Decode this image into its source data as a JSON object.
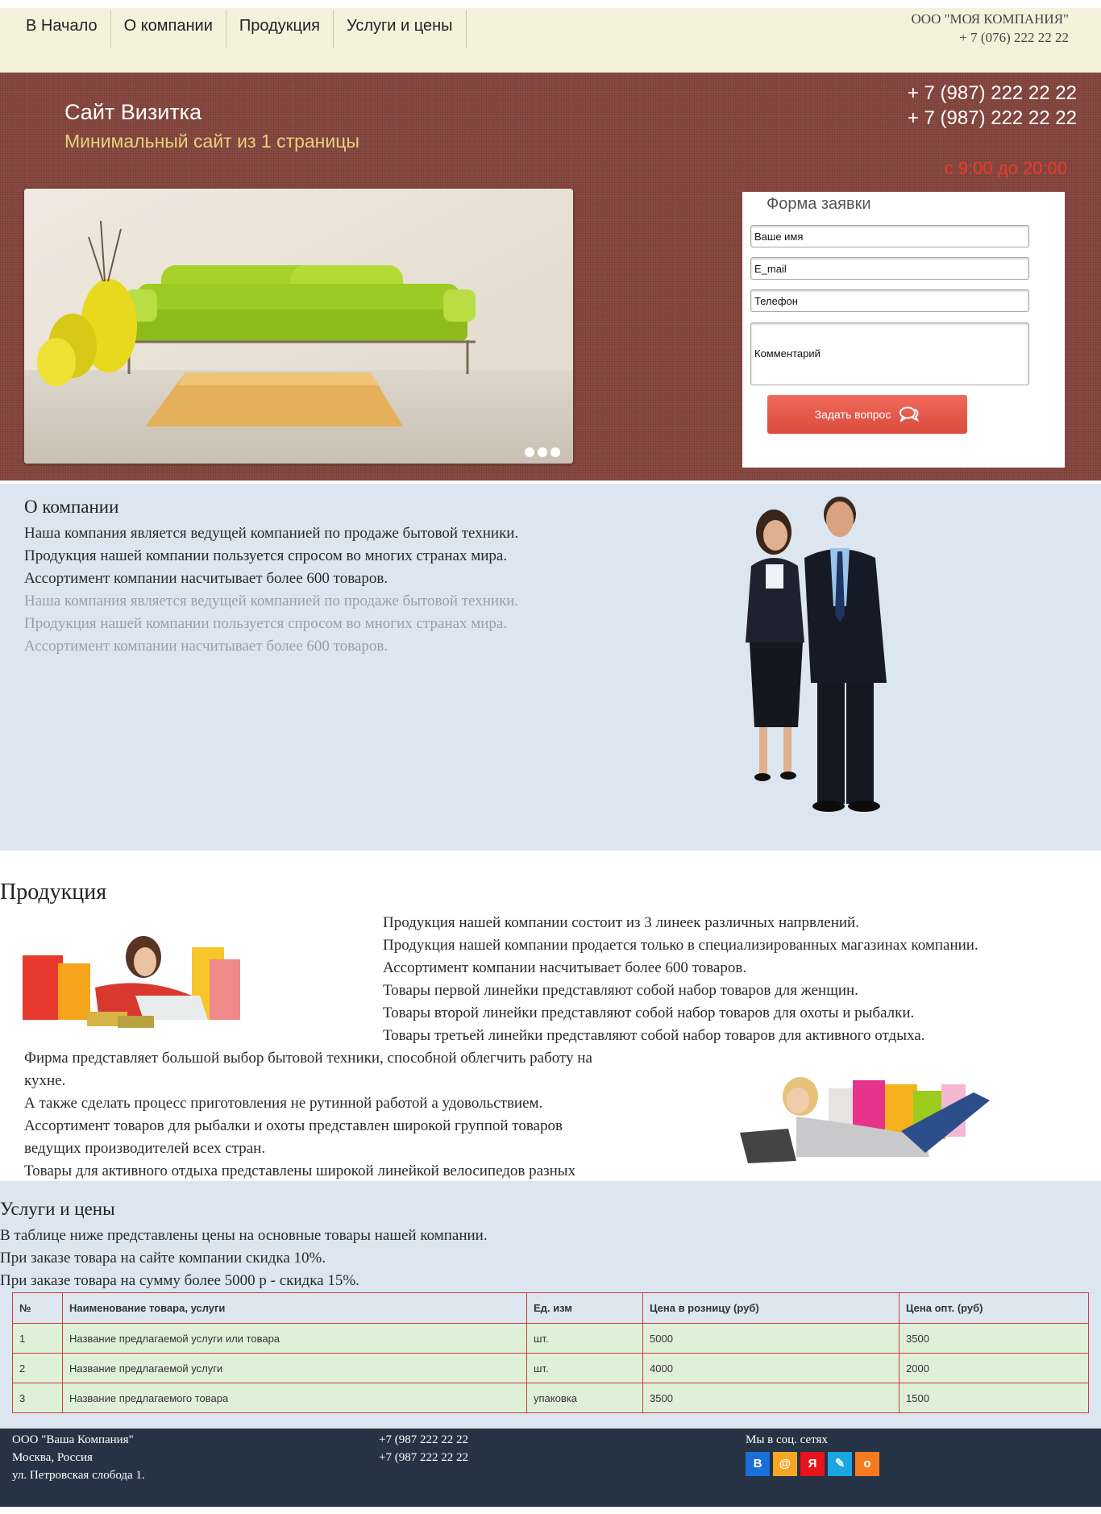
{
  "nav": {
    "items": [
      "В Начало",
      "О компании",
      "Продукция",
      "Услуги и цены"
    ]
  },
  "company_box": {
    "name": "ООО \"МОЯ КОМПАНИЯ\"",
    "phone": "+ 7 (076) 222 22 22"
  },
  "hero": {
    "title": "Сайт Визитка",
    "subtitle": "Минимальный сайт из 1 страницы",
    "phone1": "+ 7 (987) 222 22 22",
    "phone2": "+ 7 (987) 222 22 22",
    "hours": "с 9:00 до 20:00",
    "hours_color": "#ec3a2a",
    "background_color": "#8a4a43"
  },
  "form": {
    "title": "Форма заявки",
    "name_placeholder": "Ваше имя",
    "email_placeholder": "E_mail",
    "phone_placeholder": "Телефон",
    "comment_placeholder": "Комментарий",
    "submit_label": "Задать вопрос",
    "submit_icon": "chat-bubbles-icon",
    "submit_color": "#e8584a"
  },
  "about": {
    "title": "О компании",
    "lines_dark": [
      "Наша компания является ведущей компанией по продаже бытовой техники.",
      "Продукция нашей компании пользуется спросом во многих странах мира.",
      "Ассортимент компании насчитывает более 600 товаров."
    ],
    "lines_light": [
      "Наша компания является ведущей компанией по продаже бытовой техники.",
      "Продукция нашей компании пользуется спросом во многих странах мира.",
      "Ассортимент компании насчитывает более 600 товаров."
    ]
  },
  "products": {
    "title": "Продукция",
    "right_lines": [
      "Продукция нашей компании состоит из 3 линеек различных напрвлений.",
      "Продукция нашей компании продается только в специализированных магазинах компании.",
      "Ассортимент компании насчитывает более 600 товаров.",
      "Товары первой линейки представляют собой набор товаров для женщин.",
      "Товары второй линейки представляют собой набор товаров для охоты и рыбалки.",
      "Товары третьей линейки представляют собой набор товаров для активного отдыха."
    ],
    "left_lines": [
      "Фирма представляет большой выбор бытовой техники, способной облегчить работу на кухне.",
      "А также сделать процесс приготовления не рутинной работой а удовольствием.",
      "Ассортимент товаров для рыбалки и охоты представлен широкой группой товаров ведущих производителей всех стран.",
      "Товары для активного отдыха представлены широкой линейкой велосипедов разных производителей."
    ]
  },
  "services": {
    "title": "Услуги и цены",
    "intro": [
      "В таблице ниже представлены цены на основные товары нашей компании.",
      "При заказе товара на сайте компании скидка 10%.",
      "При заказе товара на сумму более 5000 р - скидка 15%."
    ],
    "table": {
      "headers": [
        "№",
        "Наименование товара, услуги",
        "Ед. изм",
        "Цена в розницу (руб)",
        "Цена опт. (руб)"
      ],
      "rows": [
        [
          "1",
          "Название предлагаемой услуги или товара",
          "шт.",
          "5000",
          "3500"
        ],
        [
          "2",
          "Название предлагаемой услуги",
          "шт.",
          "4000",
          "2000"
        ],
        [
          "3",
          "Название предлагаемого товара",
          "упаковка",
          "3500",
          "1500"
        ]
      ],
      "border_color": "#d13b3b",
      "row_color": "#dff0d8"
    }
  },
  "footer": {
    "company": "ООО \"Ваша Компания\"",
    "city": "Москва, Россия",
    "street": "ул. Петровская слобода 1.",
    "phone1": "+7 (987 222 22 22",
    "phone2": "+7 (987 222 22 22",
    "social_title": "Мы в соц. сетях",
    "social": [
      {
        "icon": "vkontakte-icon",
        "glyph": "В",
        "color": "#1a6fd9"
      },
      {
        "icon": "mailru-icon",
        "glyph": "@",
        "color": "#f5a623"
      },
      {
        "icon": "yandex-icon",
        "glyph": "Я",
        "color": "#e8141c"
      },
      {
        "icon": "livejournal-icon",
        "glyph": "✎",
        "color": "#1aa6e0"
      },
      {
        "icon": "odnoklassniki-icon",
        "glyph": "о",
        "color": "#f47b20"
      }
    ],
    "background_color": "#263345"
  }
}
